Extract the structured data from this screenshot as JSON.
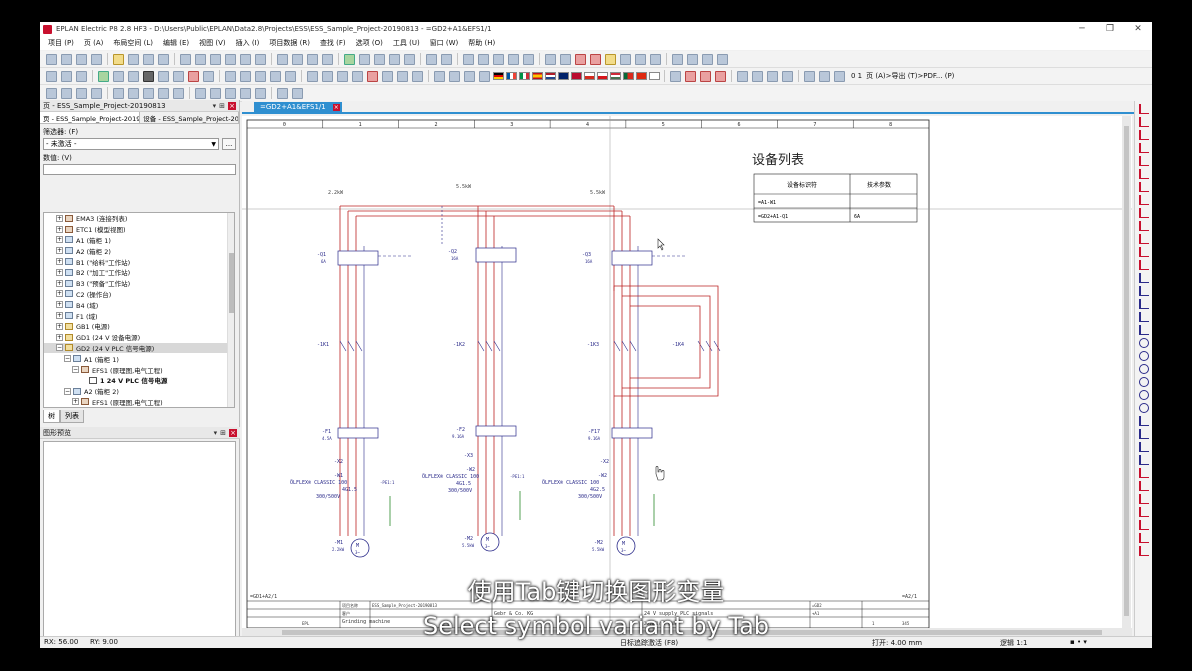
{
  "window": {
    "title": "EPLAN Electric P8 2.8 HF3 - D:\\Users\\Public\\EPLAN\\Data2.8\\Projects\\ESS\\ESS_Sample_Project-20190813 - =GD2+A1&EFS1/1",
    "minimize": "─",
    "restore": "❐",
    "close": "✕"
  },
  "menu": [
    "项目 (P)",
    "页 (A)",
    "布局空间 (L)",
    "编辑 (E)",
    "视图 (V)",
    "插入 (I)",
    "项目数据 (R)",
    "查找 (F)",
    "选项 (O)",
    "工具 (U)",
    "窗口 (W)",
    "帮助 (H)"
  ],
  "toolbar": {
    "digits": "0 1",
    "export_label": "页 (A)>导出 (T)>PDF... (P)"
  },
  "left_panel": {
    "title": "页 - ESS_Sample_Project-20190813",
    "tabs": [
      "页 - ESS_Sample_Project-2019...",
      "设备 - ESS_Sample_Project-20..."
    ],
    "filter_label": "筛选器: (F)",
    "filter_value": "- 未激活 -",
    "filter_button": "...",
    "value_label": "数值: (V)",
    "tree": [
      {
        "indent": 1,
        "exp": "+",
        "icon": "loc",
        "label": "EMA3 (连接列表)",
        "bold": false,
        "sel": false
      },
      {
        "indent": 1,
        "exp": "+",
        "icon": "loc",
        "label": "ETC1 (模型视图)",
        "bold": false,
        "sel": false
      },
      {
        "indent": 1,
        "exp": "+",
        "icon": "plus",
        "label": "A1 (箱柜 1)",
        "bold": false,
        "sel": false
      },
      {
        "indent": 1,
        "exp": "+",
        "icon": "plus",
        "label": "A2 (箱柜 2)",
        "bold": false,
        "sel": false
      },
      {
        "indent": 1,
        "exp": "+",
        "icon": "plus",
        "label": "B1 (\"给料\"工作站)",
        "bold": false,
        "sel": false
      },
      {
        "indent": 1,
        "exp": "+",
        "icon": "plus",
        "label": "B2 (\"加工\"工作站)",
        "bold": false,
        "sel": false
      },
      {
        "indent": 1,
        "exp": "+",
        "icon": "plus",
        "label": "B3 (\"预备\"工作站)",
        "bold": false,
        "sel": false
      },
      {
        "indent": 1,
        "exp": "+",
        "icon": "plus",
        "label": "C2 (操作台)",
        "bold": false,
        "sel": false
      },
      {
        "indent": 1,
        "exp": "+",
        "icon": "plus",
        "label": "B4 (域)",
        "bold": false,
        "sel": false
      },
      {
        "indent": 1,
        "exp": "+",
        "icon": "plus",
        "label": "F1 (域)",
        "bold": false,
        "sel": false
      },
      {
        "indent": 1,
        "exp": "+",
        "icon": "folder",
        "label": "GB1 (电源)",
        "bold": false,
        "sel": false
      },
      {
        "indent": 1,
        "exp": "+",
        "icon": "folder",
        "label": "GD1 (24 V 设备电源)",
        "bold": false,
        "sel": false
      },
      {
        "indent": 1,
        "exp": "−",
        "icon": "folder",
        "label": "GD2 (24 V PLC 信号电源)",
        "bold": false,
        "sel": true
      },
      {
        "indent": 2,
        "exp": "−",
        "icon": "plus",
        "label": "A1 (箱柜 1)",
        "bold": false,
        "sel": false
      },
      {
        "indent": 3,
        "exp": "−",
        "icon": "loc",
        "label": "EFS1 (原理图,电气工程)",
        "bold": false,
        "sel": false
      },
      {
        "indent": 4,
        "exp": "",
        "icon": "page",
        "label": "1 24 V PLC 信号电源",
        "bold": true,
        "sel": false
      },
      {
        "indent": 2,
        "exp": "−",
        "icon": "plus",
        "label": "A2 (箱柜 2)",
        "bold": false,
        "sel": false
      },
      {
        "indent": 3,
        "exp": "+",
        "icon": "loc",
        "label": "EFS1 (原理图,电气工程)",
        "bold": false,
        "sel": false
      }
    ],
    "bottom_tabs": [
      "树",
      "列表"
    ]
  },
  "preview_panel": {
    "title": "图形预览"
  },
  "document": {
    "tab_label": "=GD2+A1&EFS1/1",
    "columns": [
      "0",
      "1",
      "2",
      "3",
      "4",
      "5",
      "6",
      "7",
      "8"
    ],
    "table_title": "设备列表",
    "table_headers": [
      "设备标识符",
      "技术参数"
    ],
    "table_rows": [
      [
        "=A1-W1",
        ""
      ],
      [
        "=GD2+A1-Q1",
        "6A"
      ]
    ],
    "voltage_labels": [
      "2.2kW",
      "5.5kW",
      "5.5kW"
    ],
    "breakers": [
      "-Q1",
      "-Q2",
      "-Q3"
    ],
    "breaker_rating": [
      "6A",
      "16A",
      "16A"
    ],
    "contactors": [
      "-1K1",
      "-1K2",
      "-1K3",
      "-1K4"
    ],
    "overloads": [
      "-F1",
      "-F2",
      "-F17"
    ],
    "overload_rating": [
      "4.5A",
      "9.16A",
      "9.16A"
    ],
    "terminals": [
      "-X2",
      "-X3",
      "-X2"
    ],
    "cables": [
      "-W1",
      "-W2",
      "-W2"
    ],
    "cable_type": "ÖLFLEX® CLASSIC 100",
    "cable_spec": [
      "4G1.5",
      "4G1.5",
      "4G2.5"
    ],
    "cable_voltage": "300/500V",
    "motors": [
      "-M1",
      "-M2",
      "-M2"
    ],
    "motor_power": [
      "2.2kW",
      "5.5kW",
      "5.5kW"
    ],
    "pe_labels": [
      "-PE1:1",
      "-PE1:1",
      ""
    ],
    "prev_ref": "=GD1+A2/1",
    "next_ref": "=A2/1",
    "title_block": {
      "project_name_label": "项目名称",
      "project_name": "ESS_Sample_Project-20190813",
      "customer_label": "客户",
      "company": "Gebr & Co. KG",
      "machine": "Grinding machine",
      "page_desc": "24 V supply PLC signals",
      "date": "2019/2/12 周四",
      "sheet": "1",
      "total_pages": "345",
      "ref_label": "=GD2",
      "ref_sub": "+A1",
      "editor": "EPL"
    }
  },
  "statusbar": {
    "rx": "RX: 56.00",
    "ry": "RY: 9.00",
    "center": "日标追踪激活 (F8)",
    "grid": "打开: 4.00 mm",
    "logic": "逻辑 1:1"
  },
  "subtitles": {
    "zh": "使用Tab键切换图形变量",
    "en": "Select symbol variant by Tab"
  }
}
